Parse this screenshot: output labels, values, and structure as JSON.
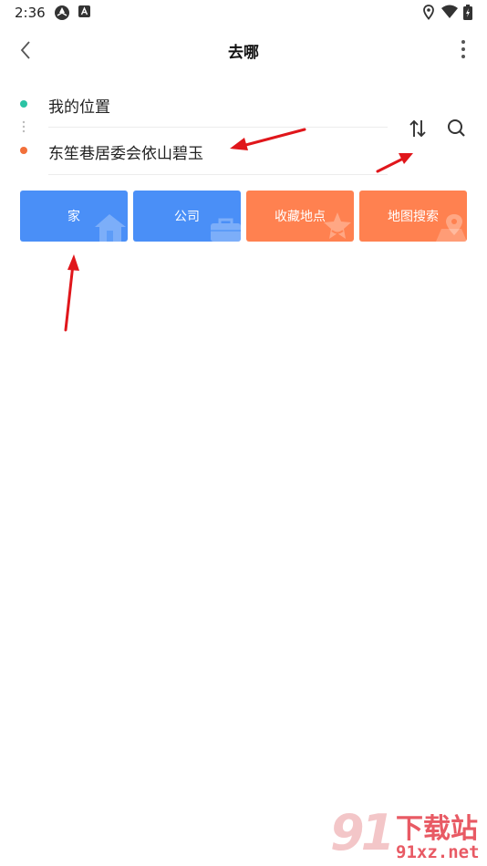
{
  "status_bar": {
    "time": "2:36"
  },
  "header": {
    "title": "去哪"
  },
  "route": {
    "origin": "我的位置",
    "destination": "东笙巷居委会依山碧玉"
  },
  "shortcuts": [
    {
      "label": "家",
      "color": "#4a8ff7"
    },
    {
      "label": "公司",
      "color": "#4a8ff7"
    },
    {
      "label": "收藏地点",
      "color": "#ff8150"
    },
    {
      "label": "地图搜索",
      "color": "#ff8150"
    }
  ],
  "colors": {
    "origin_dot": "#2bc3a4",
    "destination_dot": "#f2703a",
    "annotation_arrow": "#e0161b"
  },
  "watermark": {
    "logo": "91",
    "brand": "下载站",
    "domain": "91xz.net"
  }
}
